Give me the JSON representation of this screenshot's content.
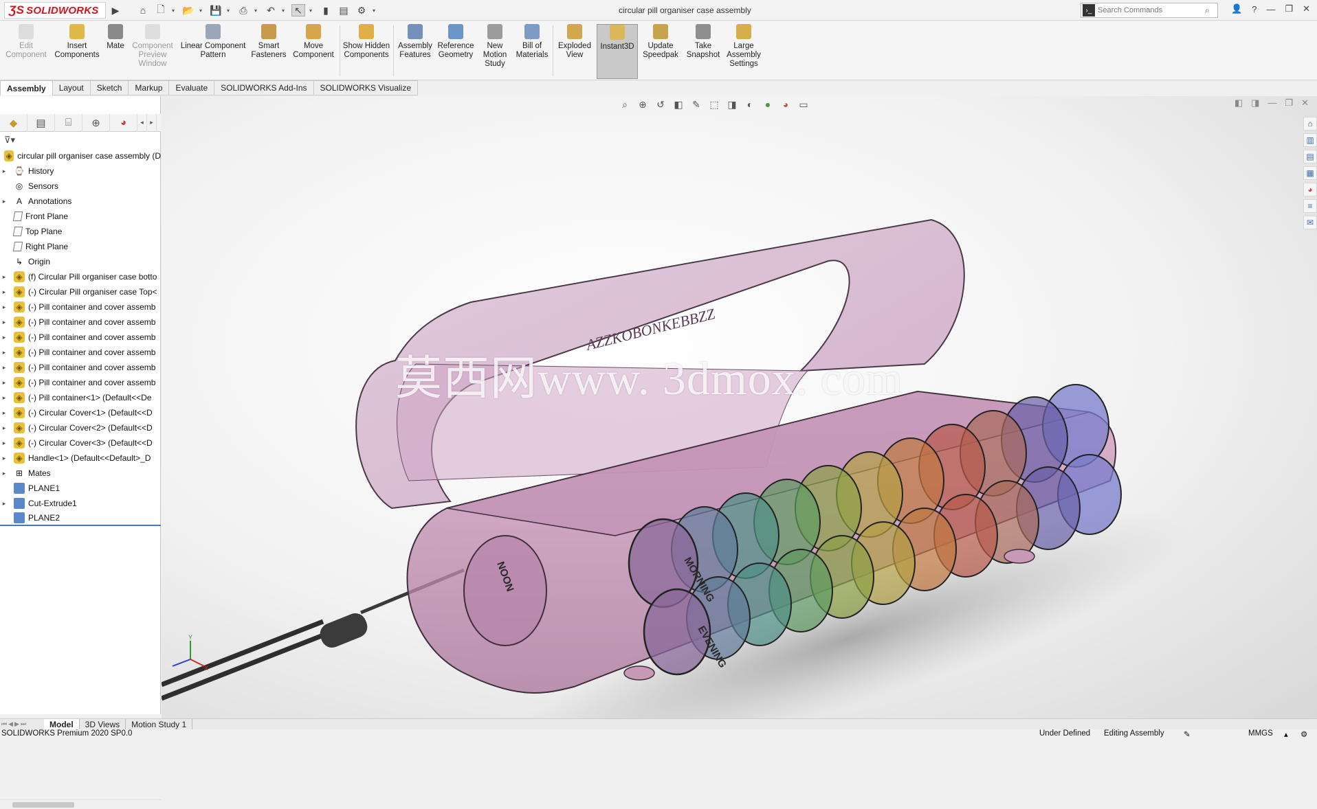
{
  "app": {
    "logo": "SOLIDWORKS",
    "document_title": "circular pill organiser case assembly"
  },
  "search": {
    "placeholder": "Search Commands"
  },
  "ribbon": {
    "buttons": [
      {
        "label": "Edit Component",
        "icon": "edit-component-icon"
      },
      {
        "label": "Insert Components",
        "icon": "insert-components-icon"
      },
      {
        "label": "Mate",
        "icon": "mate-icon"
      },
      {
        "label": "Component Preview Window",
        "icon": "preview-window-icon"
      },
      {
        "label": "Linear Component Pattern",
        "icon": "pattern-icon"
      },
      {
        "label": "Smart Fasteners",
        "icon": "fasteners-icon"
      },
      {
        "label": "Move Component",
        "icon": "move-component-icon"
      },
      {
        "label": "Show Hidden Components",
        "icon": "show-hidden-icon"
      },
      {
        "label": "Assembly Features",
        "icon": "assembly-features-icon"
      },
      {
        "label": "Reference Geometry",
        "icon": "reference-geometry-icon"
      },
      {
        "label": "New Motion Study",
        "icon": "motion-study-icon"
      },
      {
        "label": "Bill of Materials",
        "icon": "bom-icon"
      },
      {
        "label": "Exploded View",
        "icon": "exploded-view-icon"
      },
      {
        "label": "Instant3D",
        "icon": "instant3d-icon"
      },
      {
        "label": "Update Speedpak",
        "icon": "speedpak-icon"
      },
      {
        "label": "Take Snapshot",
        "icon": "snapshot-icon"
      },
      {
        "label": "Large Assembly Settings",
        "icon": "large-assembly-icon"
      }
    ]
  },
  "tabs": [
    "Assembly",
    "Layout",
    "Sketch",
    "Markup",
    "Evaluate",
    "SOLIDWORKS Add-Ins",
    "SOLIDWORKS Visualize"
  ],
  "tree": {
    "root": "circular pill organiser case assembly  (D",
    "items": [
      "History",
      "Sensors",
      "Annotations",
      "Front Plane",
      "Top Plane",
      "Right Plane",
      "Origin",
      "(f) Circular Pill organiser case botto",
      "(-) Circular Pill organiser case Top<",
      "(-) Pill container and cover assemb",
      "(-) Pill container and cover assemb",
      "(-) Pill container and cover assemb",
      "(-) Pill container and cover assemb",
      "(-) Pill container and cover assemb",
      "(-) Pill container and cover assemb",
      "(-) Pill container<1> (Default<<De",
      "(-) Circular Cover<1> (Default<<D",
      "(-) Circular Cover<2> (Default<<D",
      "(-) Circular Cover<3> (Default<<D",
      "Handle<1> (Default<<Default>_D",
      "Mates",
      "PLANE1",
      "Cut-Extrude1",
      "PLANE2"
    ]
  },
  "model_text": {
    "watermark": "莫西网www. 3dmox. com",
    "label_top": "AZZKOBONKEBBZZ",
    "label_noon": "NOON",
    "label_morning": "MORNING",
    "label_evening": "EVENING"
  },
  "bottom_tabs": [
    "Model",
    "3D Views",
    "Motion Study 1"
  ],
  "status": {
    "product": "SOLIDWORKS Premium 2020 SP0.0",
    "definition": "Under Defined",
    "mode": "Editing Assembly",
    "units": "MMGS"
  },
  "colors": {
    "accent": "#d2131b",
    "case": "#c88fb6"
  }
}
